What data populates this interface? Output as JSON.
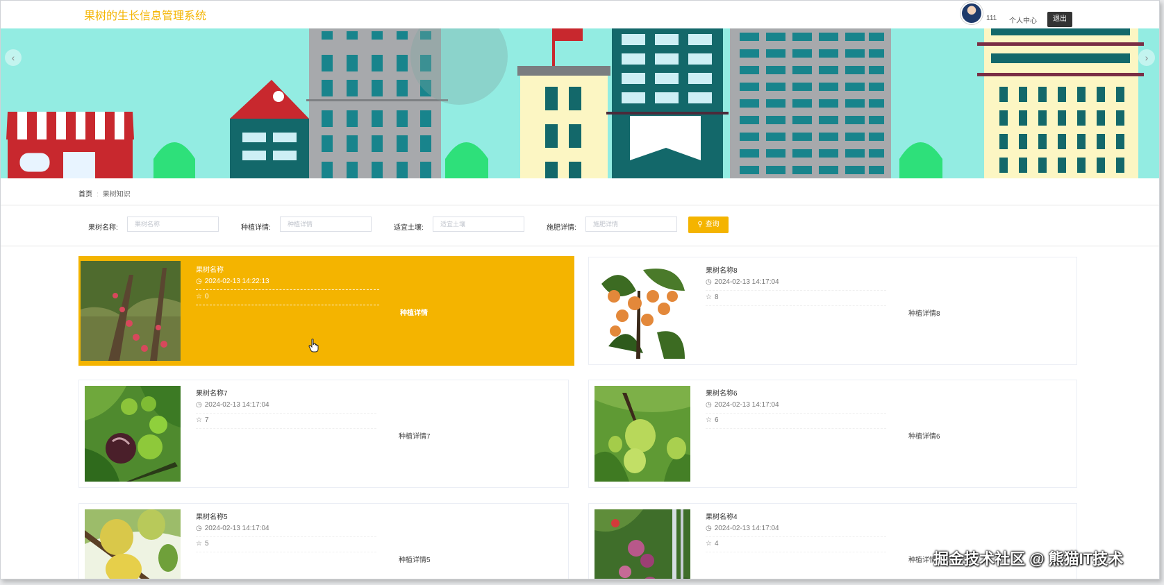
{
  "header": {
    "app_title": "果树的生长信息管理系统",
    "username": "111",
    "personal_center": "个人中心",
    "logout": "退出"
  },
  "breadcrumb": {
    "home": "首页",
    "separator": ":",
    "current": "果树知识"
  },
  "search": {
    "fields": [
      {
        "label": "果树名称:",
        "placeholder": "果树名称"
      },
      {
        "label": "种植详情:",
        "placeholder": "种植详情"
      },
      {
        "label": "适宜土壤:",
        "placeholder": "适宜土壤"
      },
      {
        "label": "施肥详情:",
        "placeholder": "施肥详情"
      }
    ],
    "button": "查询"
  },
  "cards": [
    {
      "name": "果树名称",
      "date": "2024-02-13 14:22:13",
      "likes": "0",
      "detail": "种植详情",
      "active": true,
      "image": "peach-tree-orchard"
    },
    {
      "name": "果树名称8",
      "date": "2024-02-13 14:17:04",
      "likes": "8",
      "detail": "种植详情8",
      "active": false,
      "image": "loquat-fruit"
    },
    {
      "name": "果树名称7",
      "date": "2024-02-13 14:17:04",
      "likes": "7",
      "detail": "种植详情7",
      "active": false,
      "image": "fig-fruit"
    },
    {
      "name": "果树名称6",
      "date": "2024-02-13 14:17:04",
      "likes": "6",
      "detail": "种植详情6",
      "active": false,
      "image": "pear-fruit"
    },
    {
      "name": "果树名称5",
      "date": "2024-02-13 14:17:04",
      "likes": "5",
      "detail": "种植详情5",
      "active": false,
      "image": "yellow-pear-fruit"
    },
    {
      "name": "果树名称4",
      "date": "2024-02-13 14:17:04",
      "likes": "4",
      "detail": "种植详情4",
      "active": false,
      "image": "plum-tree"
    }
  ],
  "watermark": "掘金技术社区 @ 熊猫IT技术",
  "colors": {
    "accent": "#f4b400",
    "banner_sky": "#93ece2"
  }
}
